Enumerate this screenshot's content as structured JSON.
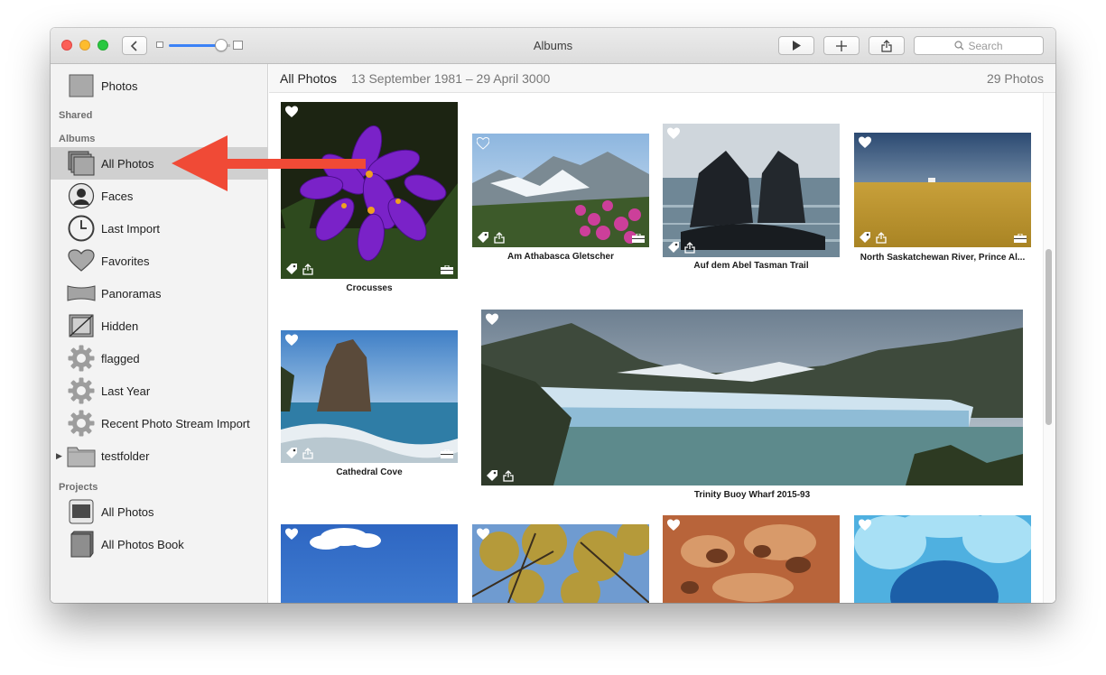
{
  "window": {
    "title": "Albums"
  },
  "toolbar": {
    "back_icon": "chevron-left-icon",
    "play_icon": "play-icon",
    "add_icon": "plus-icon",
    "share_icon": "share-icon",
    "search_placeholder": "Search",
    "thumbnail_size": 0.9
  },
  "sidebar": {
    "top_items": [
      {
        "label": "Photos",
        "icon": "photos-icon"
      }
    ],
    "sections": {
      "shared": "Shared",
      "albums": "Albums",
      "projects": "Projects"
    },
    "albums": [
      {
        "label": "All Photos",
        "icon": "all-photos-icon",
        "selected": true
      },
      {
        "label": "Faces",
        "icon": "faces-icon"
      },
      {
        "label": "Last Import",
        "icon": "clock-icon"
      },
      {
        "label": "Favorites",
        "icon": "heart-icon"
      },
      {
        "label": "Panoramas",
        "icon": "panorama-icon"
      },
      {
        "label": "Hidden",
        "icon": "hidden-icon"
      },
      {
        "label": "flagged",
        "icon": "gear-icon"
      },
      {
        "label": "Last Year",
        "icon": "gear-icon"
      },
      {
        "label": "Recent Photo Stream Import",
        "icon": "gear-icon"
      },
      {
        "label": "testfolder",
        "icon": "folder-icon",
        "collapsed": true
      }
    ],
    "projects": [
      {
        "label": "All Photos",
        "icon": "project-icon"
      },
      {
        "label": "All Photos Book",
        "icon": "book-icon"
      }
    ]
  },
  "main": {
    "header": {
      "title": "All Photos",
      "dates": "13 September 1981 – 29 April 3000",
      "count": "29 Photos"
    },
    "photos": [
      {
        "caption": "Crocusses",
        "favorite": true
      },
      {
        "caption": "Am Athabasca Gletscher",
        "favorite": false
      },
      {
        "caption": "Auf dem Abel Tasman Trail",
        "favorite": true
      },
      {
        "caption": "North Saskatchewan River, Prince Al...",
        "favorite": true
      },
      {
        "caption": "Cathedral Cove",
        "favorite": true
      },
      {
        "caption": "Trinity Buoy Wharf 2015-93",
        "favorite": true
      },
      {
        "caption": "",
        "favorite": true
      },
      {
        "caption": "",
        "favorite": true
      },
      {
        "caption": "",
        "favorite": true
      },
      {
        "caption": "",
        "favorite": true
      }
    ]
  },
  "annotation": {
    "type": "red-arrow",
    "points_to": "All Photos",
    "color": "#f04a36"
  }
}
